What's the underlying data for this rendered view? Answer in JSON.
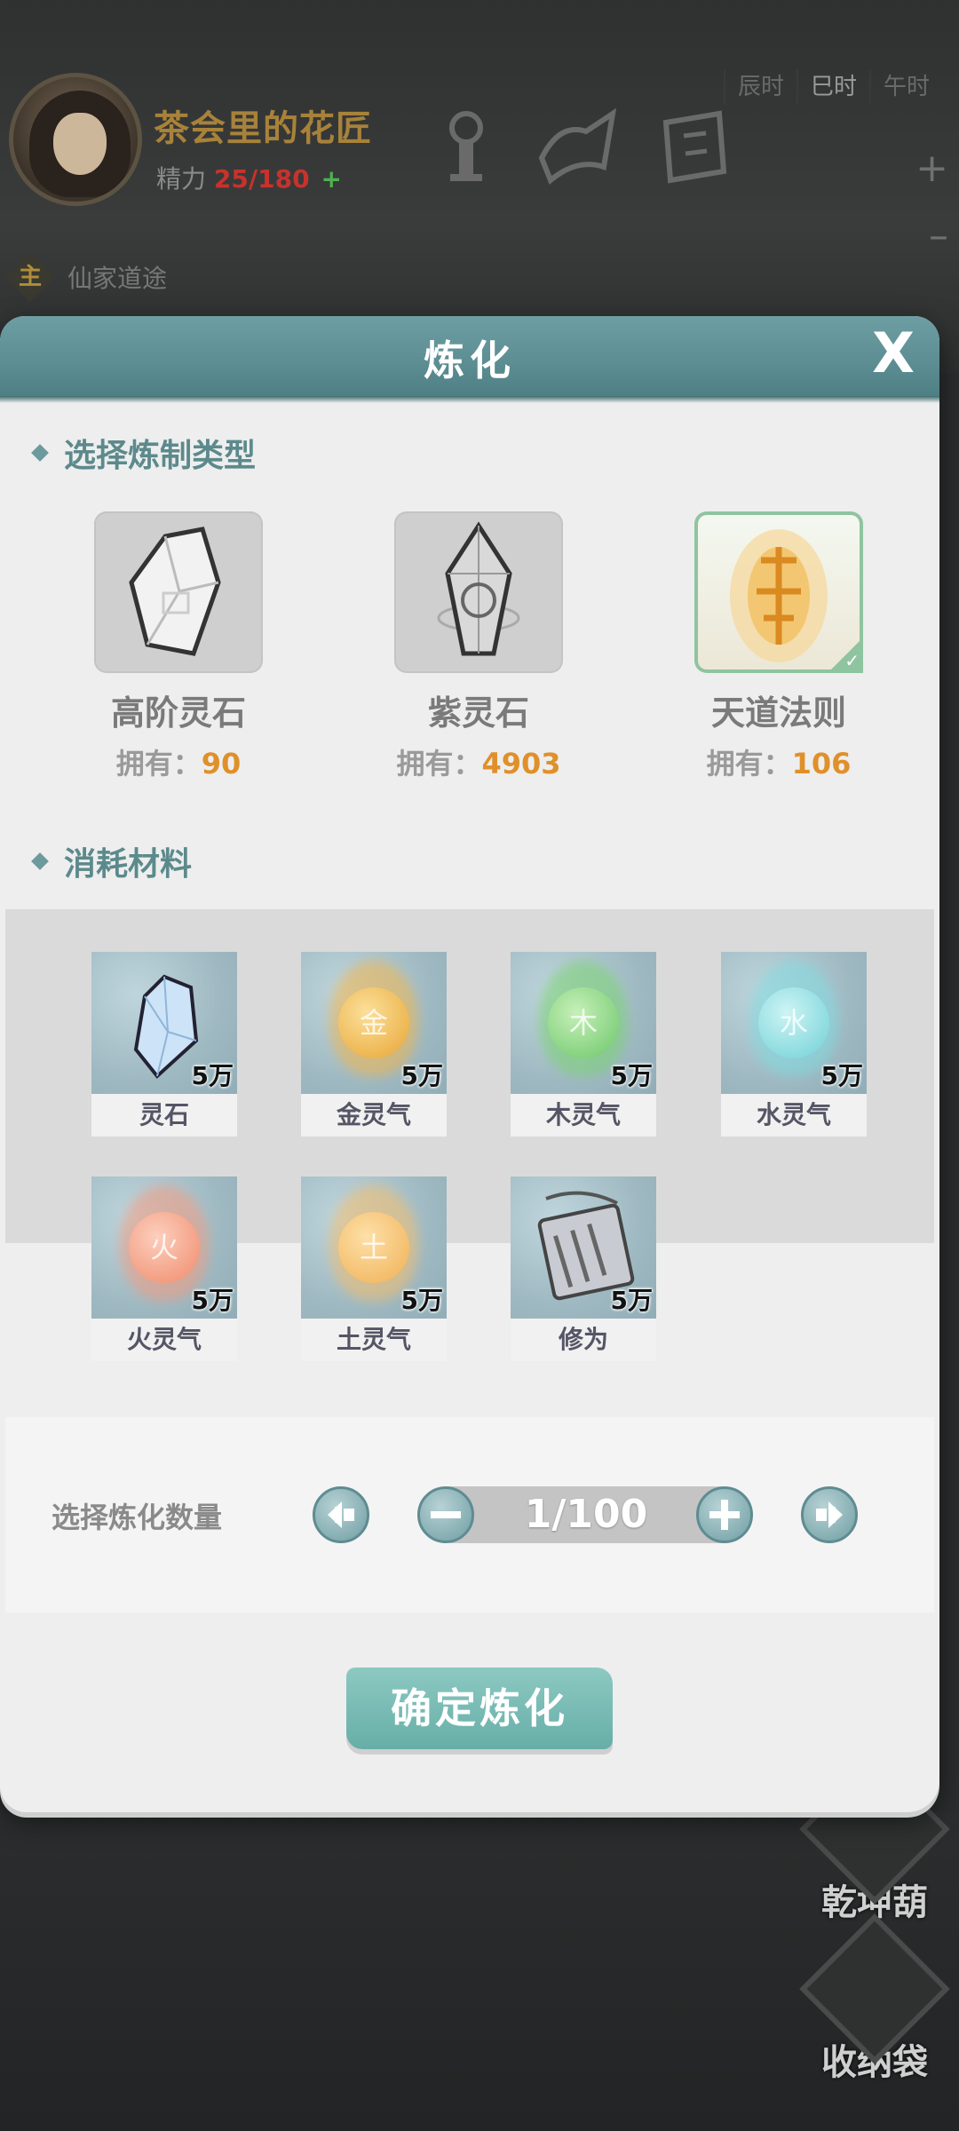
{
  "header": {
    "player_name": "茶会里的花匠",
    "energy_label": "精力",
    "energy_value": "25/180",
    "energy_plus": "+",
    "time_tabs": [
      "辰时",
      "巳时",
      "午时"
    ],
    "zoom_in": "+",
    "zoom_out": "–",
    "main_task_badge": "主",
    "main_task_text": "仙家道途"
  },
  "side_buttons": {
    "gourd": "乾坤葫",
    "bag": "收纳袋"
  },
  "dialog": {
    "title": "炼化",
    "close": "X",
    "type_section": "选择炼制类型",
    "owned_label": "拥有：",
    "types": [
      {
        "name": "高阶灵石",
        "owned": "90"
      },
      {
        "name": "紫灵石",
        "owned": "4903"
      },
      {
        "name": "天道法则",
        "owned": "106",
        "selected": true
      }
    ],
    "material_section": "消耗材料",
    "materials": [
      {
        "name": "灵石",
        "count": "5万",
        "icon": "spirit-stone-icon"
      },
      {
        "name": "金灵气",
        "count": "5万",
        "icon": "metal-qi-icon",
        "glyph": "金",
        "color": "#e8a534"
      },
      {
        "name": "木灵气",
        "count": "5万",
        "icon": "wood-qi-icon",
        "glyph": "木",
        "color": "#6cc66a"
      },
      {
        "name": "水灵气",
        "count": "5万",
        "icon": "water-qi-icon",
        "glyph": "水",
        "color": "#6fd0d6"
      },
      {
        "name": "火灵气",
        "count": "5万",
        "icon": "fire-qi-icon",
        "glyph": "火",
        "color": "#f08a6a"
      },
      {
        "name": "土灵气",
        "count": "5万",
        "icon": "earth-qi-icon",
        "glyph": "土",
        "color": "#f0b054"
      },
      {
        "name": "修为",
        "count": "5万",
        "icon": "scroll-icon"
      }
    ],
    "quantity_label": "选择炼化数量",
    "quantity_value": "1/100",
    "confirm": "确定炼化"
  }
}
